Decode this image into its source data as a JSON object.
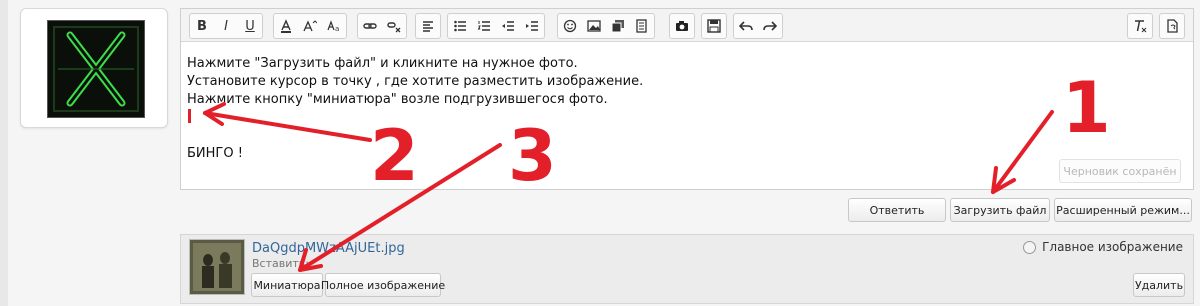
{
  "editor": {
    "lines": [
      "Нажмите \"Загрузить файл\" и кликните на нужное фото.",
      "Установите курсор в точку , где хотите разместить изображение.",
      "Нажмите кнопку \"миниатюра\" возле подгрузившегося фото.",
      "",
      "",
      "БИНГО !"
    ],
    "draft_saved": "Черновик сохранён"
  },
  "toolbar": {
    "bold": "B",
    "italic": "I",
    "underline": "U"
  },
  "actions": {
    "reply": "Ответить",
    "upload": "Загрузить файл",
    "advanced": "Расширенный режим..."
  },
  "attachment": {
    "filename": "DaQgdpMWzAAjUEt.jpg",
    "insert_label": "Вставить:",
    "thumbnail_button": "Миниатюра",
    "full_button": "Полное изображение",
    "delete_button": "Удалить",
    "main_image_label": "Главное изображение"
  },
  "annotations": {
    "marks": [
      "1",
      "2",
      "3"
    ],
    "color": "#e3202a"
  },
  "colors": {
    "accent": "#336699"
  }
}
